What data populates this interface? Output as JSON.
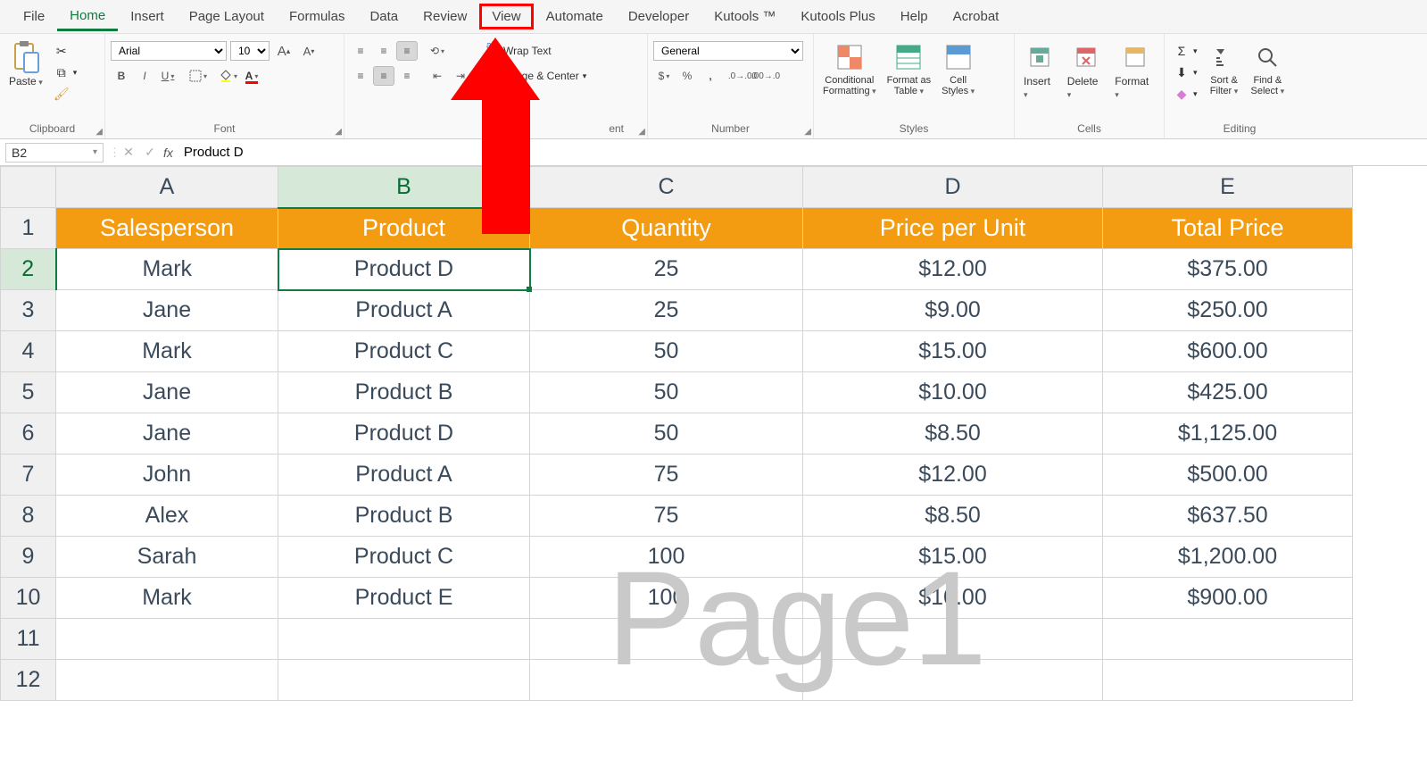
{
  "menu": {
    "items": [
      "File",
      "Home",
      "Insert",
      "Page Layout",
      "Formulas",
      "Data",
      "Review",
      "View",
      "Automate",
      "Developer",
      "Kutools ™",
      "Kutools Plus",
      "Help",
      "Acrobat"
    ],
    "active": "Home",
    "highlighted": "View"
  },
  "ribbon": {
    "clipboard": {
      "paste": "Paste",
      "label": "Clipboard"
    },
    "font": {
      "name": "Arial",
      "size": "10",
      "label": "Font"
    },
    "alignment": {
      "wrap": "Wrap Text",
      "merge": "Merge & Center",
      "label_suffix": "ent"
    },
    "number": {
      "format": "General",
      "label": "Number"
    },
    "styles": {
      "conditional": "Conditional Formatting",
      "table": "Format as Table",
      "cell": "Cell Styles",
      "label": "Styles"
    },
    "cells": {
      "insert": "Insert",
      "delete": "Delete",
      "format": "Format",
      "label": "Cells"
    },
    "editing": {
      "sort": "Sort & Filter",
      "find": "Find & Select",
      "label": "Editing"
    }
  },
  "formula_bar": {
    "cell_ref": "B2",
    "formula": "Product D"
  },
  "columns": [
    "A",
    "B",
    "C",
    "D",
    "E"
  ],
  "header_row": [
    "Salesperson",
    "Product",
    "Quantity",
    "Price per Unit",
    "Total Price"
  ],
  "rows": [
    {
      "n": 1
    },
    {
      "n": 2,
      "cells": [
        "Mark",
        "Product D",
        "25",
        "$12.00",
        "$375.00"
      ]
    },
    {
      "n": 3,
      "cells": [
        "Jane",
        "Product A",
        "25",
        "$9.00",
        "$250.00"
      ]
    },
    {
      "n": 4,
      "cells": [
        "Mark",
        "Product C",
        "50",
        "$15.00",
        "$600.00"
      ]
    },
    {
      "n": 5,
      "cells": [
        "Jane",
        "Product B",
        "50",
        "$10.00",
        "$425.00"
      ]
    },
    {
      "n": 6,
      "cells": [
        "Jane",
        "Product D",
        "50",
        "$8.50",
        "$1,125.00"
      ]
    },
    {
      "n": 7,
      "cells": [
        "John",
        "Product A",
        "75",
        "$12.00",
        "$500.00"
      ]
    },
    {
      "n": 8,
      "cells": [
        "Alex",
        "Product B",
        "75",
        "$8.50",
        "$637.50"
      ]
    },
    {
      "n": 9,
      "cells": [
        "Sarah",
        "Product C",
        "100",
        "$15.00",
        "$1,200.00"
      ]
    },
    {
      "n": 10,
      "cells": [
        "Mark",
        "Product E",
        "100",
        "$10.00",
        "$900.00"
      ]
    },
    {
      "n": 11
    },
    {
      "n": 12
    }
  ],
  "selected_cell": "B2",
  "watermark": "Page1"
}
